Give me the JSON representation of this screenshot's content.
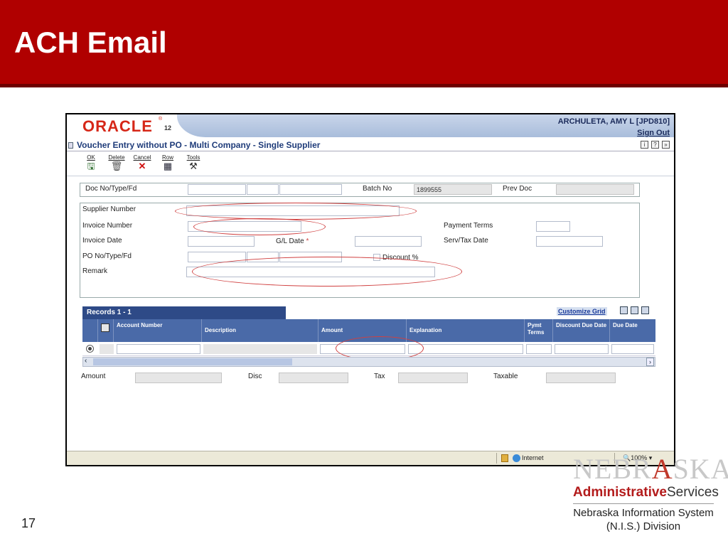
{
  "slide": {
    "title": "ACH Email",
    "page_number": "17"
  },
  "app": {
    "logo": "ORACLE",
    "logo_registered": "®",
    "logo_version": "12",
    "user": "ARCHULETA, AMY L [JPD810]",
    "sign_out": "Sign Out",
    "title": "Voucher Entry without PO - Multi Company - Single Supplier",
    "top_icons": [
      "i",
      "?",
      "»"
    ]
  },
  "toolbar": [
    {
      "label": "OK",
      "icon": "save-icon",
      "glyph": "🖫"
    },
    {
      "label": "Delete",
      "icon": "trash-icon",
      "glyph": "🗑"
    },
    {
      "label": "Cancel",
      "icon": "x-icon",
      "glyph": "✕"
    },
    {
      "label": "Row",
      "icon": "grid-icon",
      "glyph": "▦"
    },
    {
      "label": "Tools",
      "icon": "tools-icon",
      "glyph": "⚒"
    }
  ],
  "header_form": {
    "doc_label": "Doc No/Type/Fd",
    "batch_label": "Batch No",
    "batch_value": "1899555",
    "prev_doc_label": "Prev Doc"
  },
  "main_form": {
    "supplier_label": "Supplier Number",
    "invoice_number_label": "Invoice Number",
    "payment_terms_label": "Payment Terms",
    "invoice_date_label": "Invoice Date",
    "gl_date_label": "G/L Date",
    "required_mark": "*",
    "serv_tax_date_label": "Serv/Tax Date",
    "po_label": "PO No/Type/Fd",
    "discount_label": "Discount %",
    "remark_label": "Remark"
  },
  "grid": {
    "records_label": "Records 1 - 1",
    "customize_label": "Customize Grid",
    "columns": [
      "Account Number",
      "Description",
      "Amount",
      "Explanation",
      "Pymt Terms",
      "Discount Due Date",
      "Due Date"
    ]
  },
  "totals": {
    "amount_label": "Amount",
    "disc_label": "Disc",
    "tax_label": "Tax",
    "taxable_label": "Taxable"
  },
  "status_bar": {
    "zone": "Internet",
    "zoom": "100%"
  },
  "branding": {
    "nebraska_prefix": "NEBR",
    "nebraska_star": "A",
    "nebraska_suffix": "SKA",
    "admin_bold": "Administrative",
    "admin_rest": "Services",
    "nis_line1": "Nebraska Information System",
    "nis_line2": "(N.I.S.) Division"
  },
  "colors": {
    "slide_red": "#b00000",
    "oracle_red": "#d62718",
    "grid_header_blue": "#4a6aa8",
    "annotation_red": "#d04040"
  }
}
